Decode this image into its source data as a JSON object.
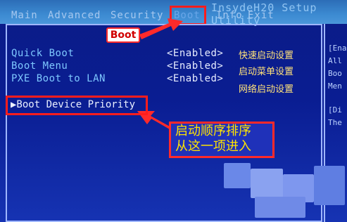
{
  "header": {
    "title": "InsydeH20 Setup Utility",
    "tabs": [
      "Main",
      "Advanced",
      "Security",
      "Boot",
      "Info",
      "Exit"
    ],
    "active_tab": "Boot"
  },
  "annotations": {
    "tab_callout": "Boot",
    "cn_arrow_callout_line1": "启动顺序排序",
    "cn_arrow_callout_line2": "从这一项进入"
  },
  "settings": [
    {
      "label": "Quick Boot",
      "value": "<Enabled>",
      "note_cn": "快速启动设置"
    },
    {
      "label": "Boot Menu",
      "value": "<Enabled>",
      "note_cn": "启动菜单设置"
    },
    {
      "label": "PXE Boot to LAN",
      "value": "<Enabled>",
      "note_cn": "网络启动设置"
    }
  ],
  "menu": {
    "boot_device_priority": "▶Boot Device Priority"
  },
  "right_panel_cutoff": [
    "[Ena",
    "All",
    "Boo",
    "Men",
    "[Di",
    "The"
  ],
  "colors": {
    "bios_blue": "#0b1c86",
    "tab_bar_blue": "#3c8ad1",
    "highlight_red": "#ff1d1d",
    "callout_yellow": "#ffe300"
  }
}
